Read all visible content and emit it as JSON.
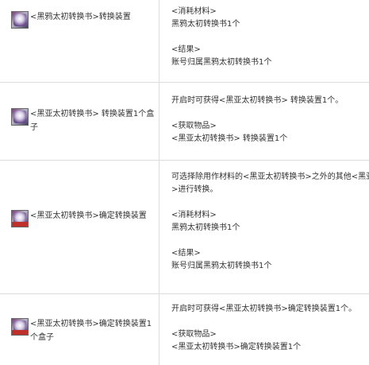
{
  "rows": [
    {
      "item": "<黑鸦太初转换书>转换装置",
      "desc": [
        "<消耗材料>",
        "黑鸦太初转换书1个",
        "",
        "<结果>",
        "账号归属黑鸦太初转换书1个"
      ]
    },
    {
      "item": "<黑亚太初转换书> 转换装置1个盒子",
      "desc": [
        "开启时可获得<黑亚太初转换书> 转换装置1个。",
        "",
        "<获取物品>",
        "<黑亚太初转换书> 转换装置1个"
      ]
    },
    {
      "item": "<黑亚太初转换书>确定转换装置",
      "desc": [
        "可选择除用作材料的<黑亚太初转换书>之外的其他<黑亚",
        ">进行转换。",
        "",
        "<消耗材料>",
        "黑鸦太初转换书1个",
        "",
        "<结果>",
        "账号归属黑鸦太初转换书1个"
      ]
    },
    {
      "item": "<黑亚太初转换书>确定转换装置1个盒子",
      "desc": [
        "开启时可获得<黑亚太初转换书>确定转换装置1个。",
        "",
        "<获取物品>",
        "<黑亚太初转换书>确定转换装置1个"
      ]
    }
  ]
}
